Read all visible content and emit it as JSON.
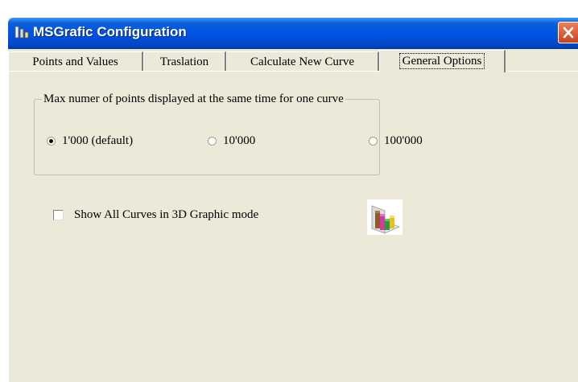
{
  "window": {
    "title": "MSGrafic Configuration",
    "icons": {
      "app": "bar-chart-app-icon",
      "close": "close-icon"
    }
  },
  "tabs": [
    {
      "label": "Points and Values",
      "active": false
    },
    {
      "label": "Traslation",
      "active": false
    },
    {
      "label": "Calculate New Curve",
      "active": false
    },
    {
      "label": "General Options",
      "active": true
    }
  ],
  "general_options": {
    "points_group": {
      "legend": "Max numer of points displayed at the same time for one curve",
      "options": [
        {
          "label": "1'000 (default)",
          "selected": true
        },
        {
          "label": "10'000",
          "selected": false
        },
        {
          "label": "100'000",
          "selected": false
        }
      ]
    },
    "show_3d": {
      "label": "Show All Curves in 3D Graphic mode",
      "checked": false,
      "icon": "3d-chart-icon"
    }
  },
  "colors": {
    "dialog_background": "#ece9d8",
    "titlebar_blue": "#0054e3",
    "close_button": "#d65a34"
  }
}
